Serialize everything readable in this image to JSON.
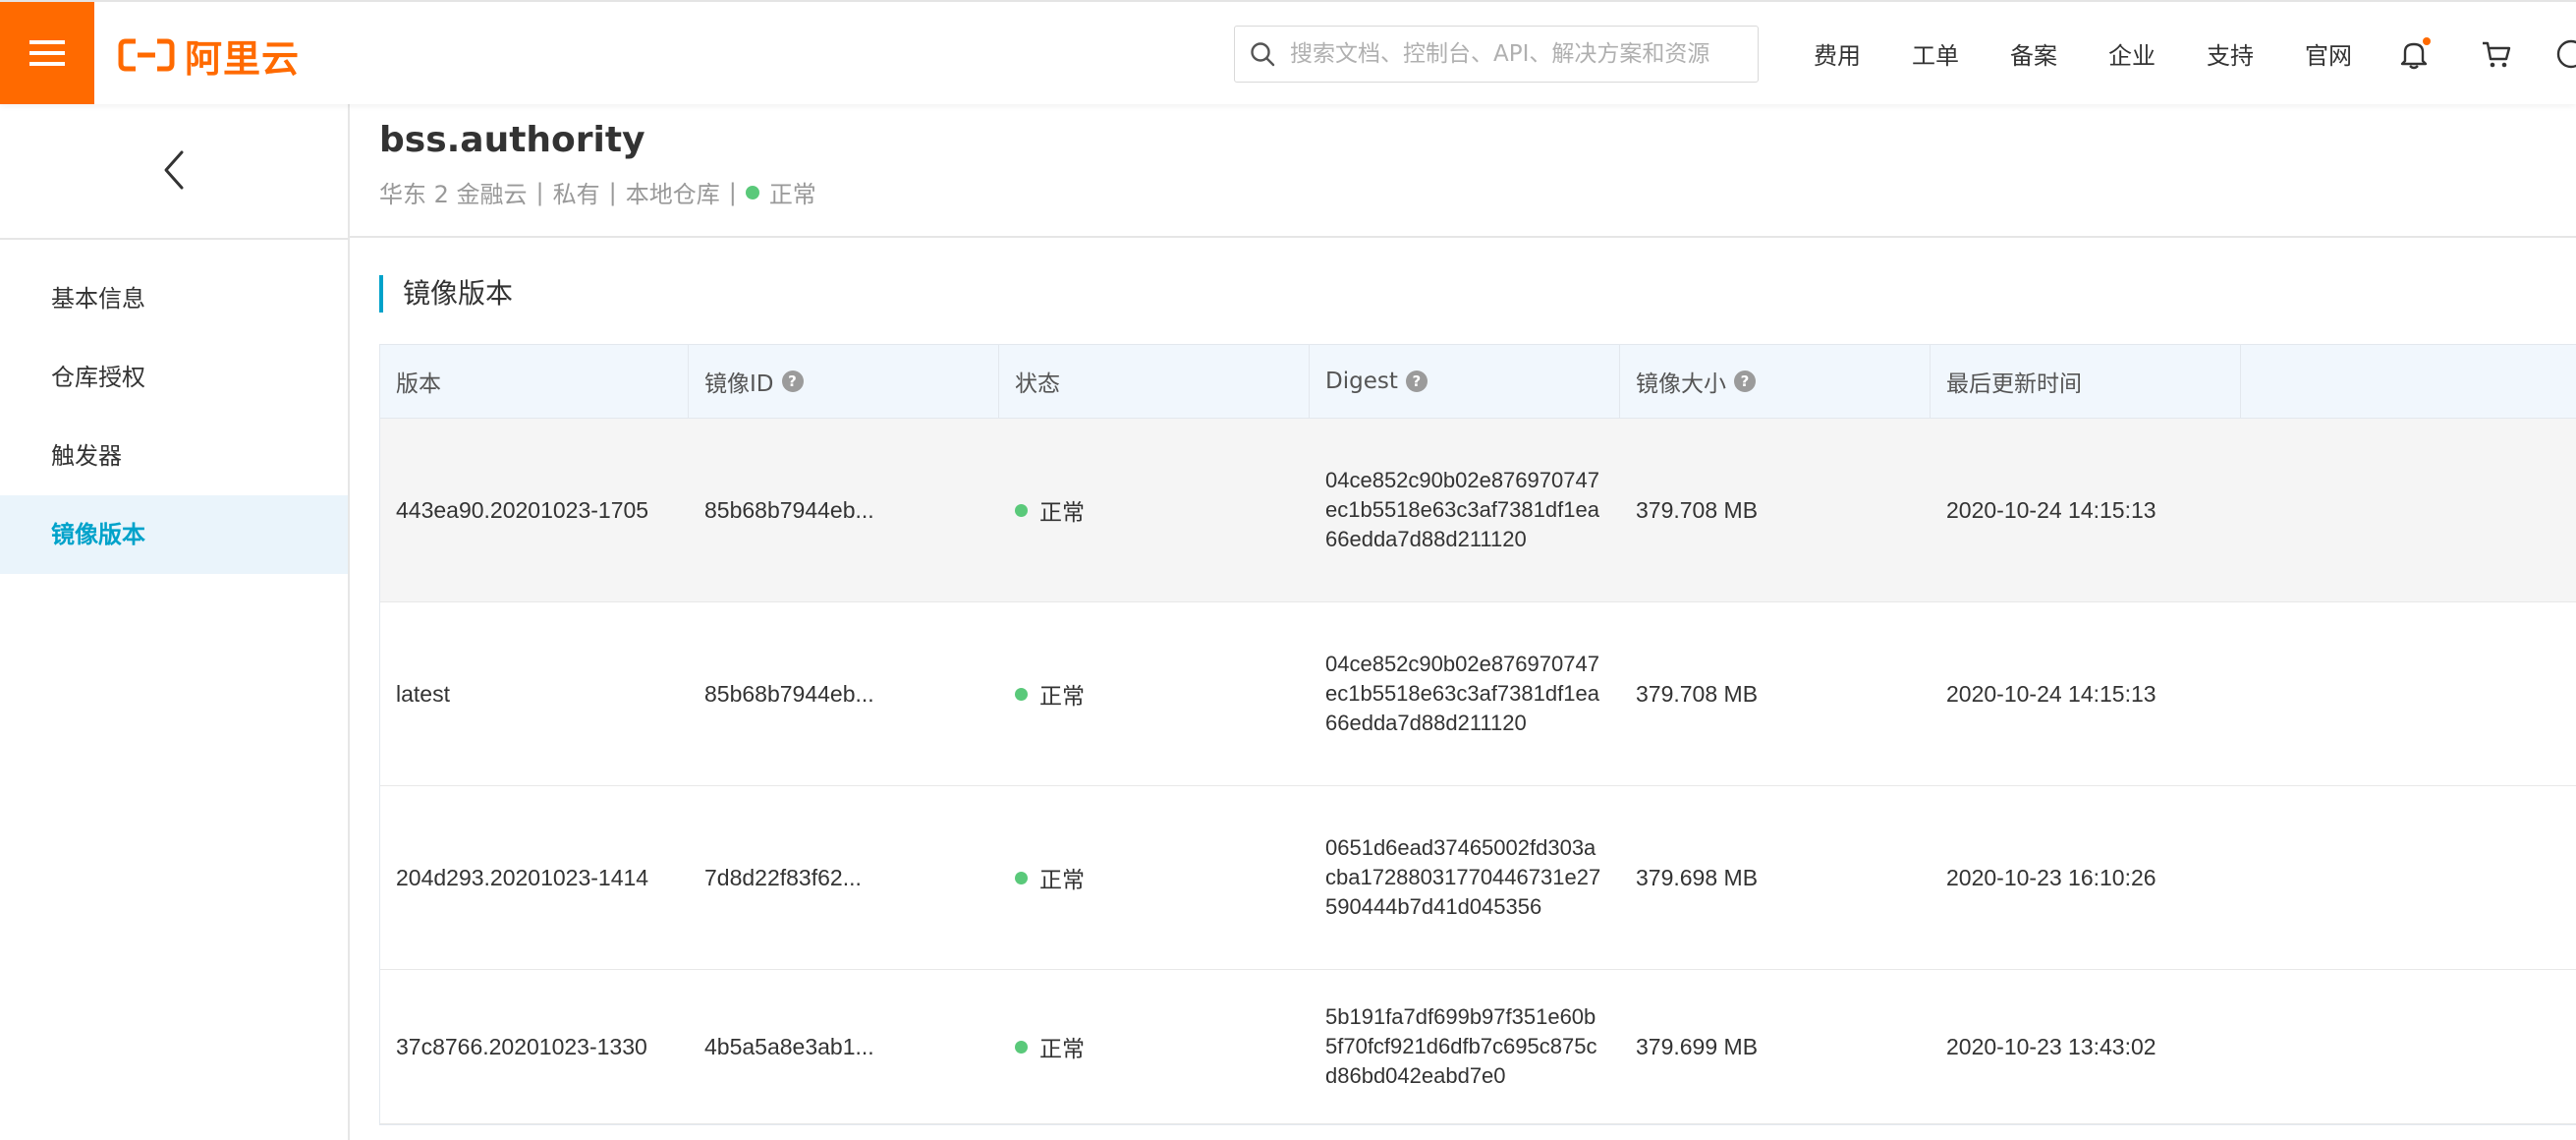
{
  "topbar": {
    "logo_text": "阿里云",
    "search_placeholder": "搜索文档、控制台、API、解决方案和资源",
    "nav": [
      "费用",
      "工单",
      "备案",
      "企业",
      "支持",
      "官网"
    ],
    "brand_color": "#ff6a00"
  },
  "sidebar": {
    "items": [
      {
        "label": "基本信息"
      },
      {
        "label": "仓库授权"
      },
      {
        "label": "触发器"
      },
      {
        "label": "镜像版本"
      }
    ],
    "active_index": 3
  },
  "repo": {
    "name": "bss.authority",
    "region": "华东 2 金融云",
    "sep": "|",
    "visibility": "私有",
    "source": "本地仓库",
    "status": "正常"
  },
  "section": {
    "title": "镜像版本"
  },
  "table": {
    "columns": [
      "版本",
      "镜像ID",
      "状态",
      "Digest",
      "镜像大小",
      "最后更新时间"
    ],
    "help_mark": "?",
    "rows": [
      {
        "version": "443ea90.20201023-1705",
        "image_id": "85b68b7944eb...",
        "status": "正常",
        "digest": "04ce852c90b02e876970747ec1b5518e63c3af7381df1ea66edda7d88d211120",
        "size": "379.708 MB",
        "updated": "2020-10-24 14:15:13"
      },
      {
        "version": "latest",
        "image_id": "85b68b7944eb...",
        "status": "正常",
        "digest": "04ce852c90b02e876970747ec1b5518e63c3af7381df1ea66edda7d88d211120",
        "size": "379.708 MB",
        "updated": "2020-10-24 14:15:13"
      },
      {
        "version": "204d293.20201023-1414",
        "image_id": "7d8d22f83f62...",
        "status": "正常",
        "digest": "0651d6ead37465002fd303acba17288031770446731e27590444b7d41d045356",
        "size": "379.698 MB",
        "updated": "2020-10-23 16:10:26"
      },
      {
        "version": "37c8766.20201023-1330",
        "image_id": "4b5a5a8e3ab1...",
        "status": "正常",
        "digest": "5b191fa7df699b97f351e60b5f70fcf921d6dfb7c695c875cd86bd042eabd7e0",
        "size": "379.699 MB",
        "updated": "2020-10-23 13:43:02"
      }
    ]
  }
}
